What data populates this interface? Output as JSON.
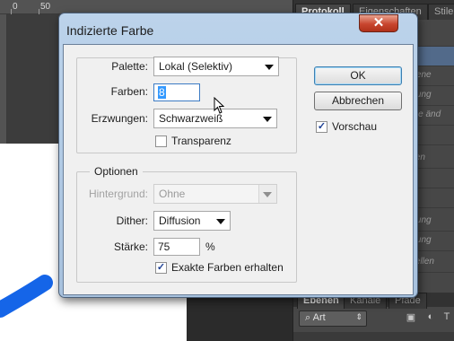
{
  "app": {
    "ruler_numbers": [
      "0",
      "50"
    ],
    "panel_tabs": [
      "Protokoll",
      "Eigenschaften",
      "Stile"
    ],
    "panel_rows": [
      "",
      "rbene",
      "erung",
      "ene änd",
      "",
      "tzen",
      "",
      "",
      "erung",
      "erung",
      "stellen"
    ],
    "layers_tabs": [
      "Ebenen",
      "Kanäle",
      "Pfade"
    ],
    "layers_filter": "Art",
    "brush_color": "#1565e8"
  },
  "dialog": {
    "title": "Indizierte Farbe",
    "close_glyph": "✕",
    "palette_label": "Palette:",
    "palette_value": "Lokal (Selektiv)",
    "colors_label": "Farben:",
    "colors_value": "8",
    "forced_label": "Erzwungen:",
    "forced_value": "Schwarzweiß",
    "transparency_label": "Transparenz",
    "transparency_checked": false,
    "options_title": "Optionen",
    "matte_label": "Hintergrund:",
    "matte_value": "Ohne",
    "dither_label": "Dither:",
    "dither_value": "Diffusion",
    "amount_label": "Stärke:",
    "amount_value": "75",
    "amount_unit": "%",
    "preserve_label": "Exakte Farben erhalten",
    "preserve_checked": true,
    "ok_label": "OK",
    "cancel_label": "Abbrechen",
    "preview_label": "Vorschau",
    "preview_checked": true
  }
}
